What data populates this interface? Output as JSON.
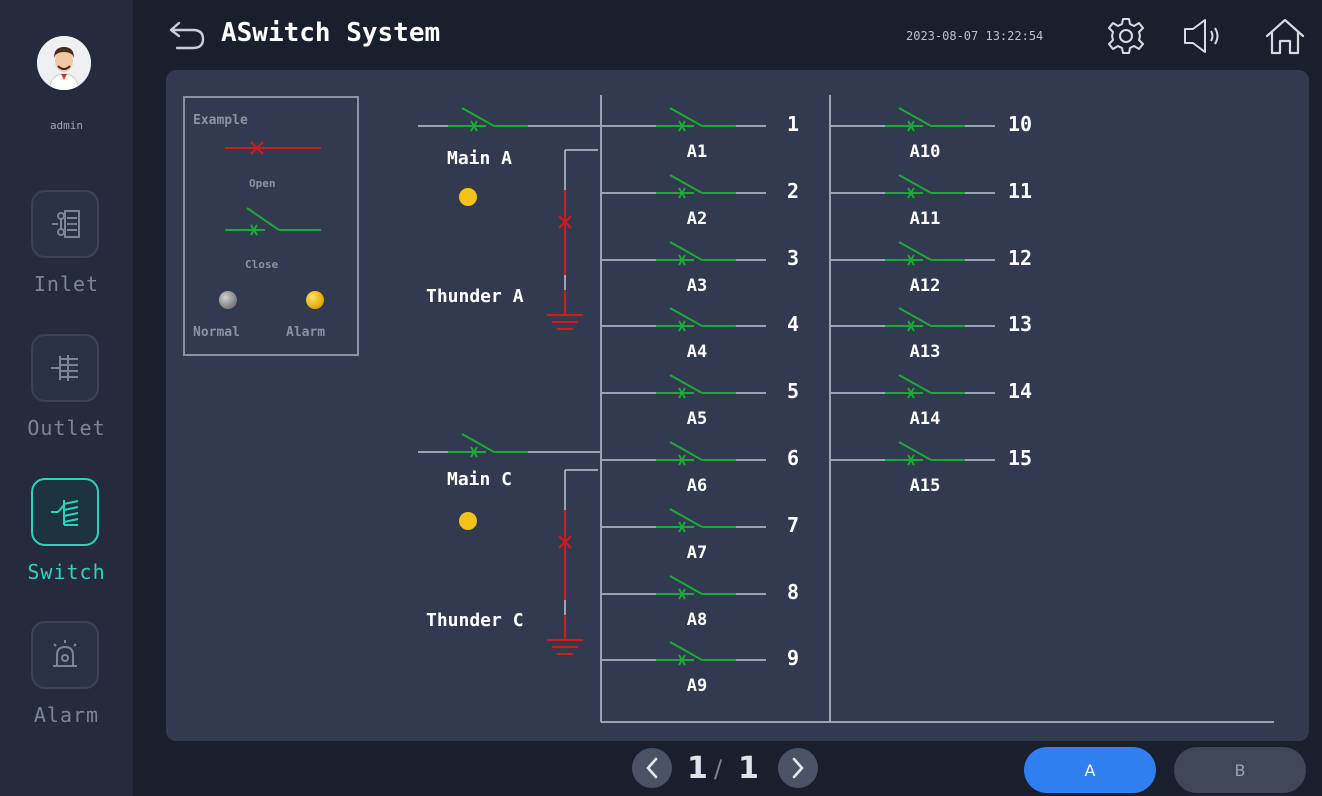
{
  "app": {
    "title": "ASwitch System",
    "datetime": "2023-08-07 13:22:54"
  },
  "user": {
    "name": "admin"
  },
  "sidebar": {
    "items": [
      {
        "label": "Inlet",
        "icon": "inlet-icon",
        "active": false
      },
      {
        "label": "Outlet",
        "icon": "outlet-icon",
        "active": false
      },
      {
        "label": "Switch",
        "icon": "switch-icon",
        "active": true
      },
      {
        "label": "Alarm",
        "icon": "alarm-icon",
        "active": false
      }
    ]
  },
  "legend": {
    "title": "Example",
    "open_label": "Open",
    "close_label": "Close",
    "normal_label": "Normal",
    "alarm_label": "Alarm"
  },
  "inputs": [
    {
      "main_label": "Main A",
      "thunder_label": "Thunder A",
      "status": "alarm"
    },
    {
      "main_label": "Main C",
      "thunder_label": "Thunder C",
      "status": "alarm"
    }
  ],
  "switches": [
    {
      "name": "A1",
      "num": "1",
      "state": "close"
    },
    {
      "name": "A2",
      "num": "2",
      "state": "close"
    },
    {
      "name": "A3",
      "num": "3",
      "state": "close"
    },
    {
      "name": "A4",
      "num": "4",
      "state": "close"
    },
    {
      "name": "A5",
      "num": "5",
      "state": "close"
    },
    {
      "name": "A6",
      "num": "6",
      "state": "close"
    },
    {
      "name": "A7",
      "num": "7",
      "state": "close"
    },
    {
      "name": "A8",
      "num": "8",
      "state": "close"
    },
    {
      "name": "A9",
      "num": "9",
      "state": "close"
    },
    {
      "name": "A10",
      "num": "10",
      "state": "close"
    },
    {
      "name": "A11",
      "num": "11",
      "state": "close"
    },
    {
      "name": "A12",
      "num": "12",
      "state": "close"
    },
    {
      "name": "A13",
      "num": "13",
      "state": "close"
    },
    {
      "name": "A14",
      "num": "14",
      "state": "close"
    },
    {
      "name": "A15",
      "num": "15",
      "state": "close"
    }
  ],
  "pager": {
    "current": "1",
    "separator": "/",
    "total": "1"
  },
  "tabs": [
    {
      "label": "A",
      "active": true
    },
    {
      "label": "B",
      "active": false
    }
  ],
  "colors": {
    "accent": "#2dd3bd",
    "closed_switch": "#1fa83a",
    "open_switch": "#d11a1a",
    "alarm_dot": "#f2c21b",
    "normal_dot": "#9a9a9a",
    "active_tab": "#2f7ff0"
  },
  "header_icons": [
    "back-icon",
    "settings-icon",
    "speaker-icon",
    "home-icon"
  ]
}
